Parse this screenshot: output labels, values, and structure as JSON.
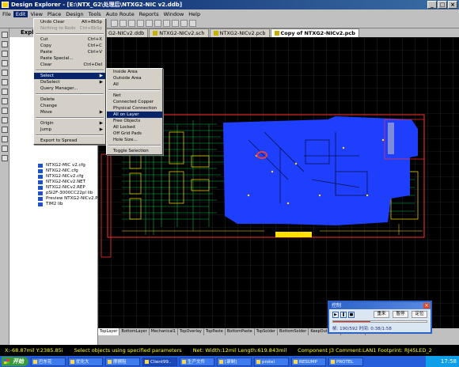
{
  "window": {
    "title": "Design Explorer - [E:\\NTX_G2\\处理后\\NTXG2-NIC v2.ddb]",
    "buttons": [
      "_",
      "□",
      "×"
    ]
  },
  "menubar": {
    "items": [
      "File",
      "Edit",
      "View",
      "Place",
      "Design",
      "Tools",
      "Auto Route",
      "Reports",
      "Window",
      "Help"
    ],
    "active": "Edit"
  },
  "explorer": {
    "header": "Expl",
    "files": [
      "NTXG2-MIC v2.cfg",
      "NTXG2-NIC.cfg",
      "NTXG2-NICv2.cfg",
      "NTXG2-NICv2.NET",
      "NTXG2-NICv2.REP",
      "pSI2F-3000CC22pl lib",
      "Preview NTXG2-NICv2.PCB",
      "TIM2 lib"
    ]
  },
  "doc_tabs": [
    {
      "label": "G2-NICv2.ddb",
      "active": false
    },
    {
      "label": "NTXG2-NICv2.sch",
      "active": false
    },
    {
      "label": "NTXG2-NICv2.pcb",
      "active": false
    },
    {
      "label": "Copy of NTXG2-NICv2.pcb",
      "active": true
    }
  ],
  "edit_menu": [
    {
      "label": "Undo  Clear",
      "shortcut": "Alt+BkSp"
    },
    {
      "label": "Nothing to Redo",
      "shortcut": "Ctrl+BkSp"
    },
    {
      "sep": true
    },
    {
      "label": "Cut",
      "shortcut": "Ctrl+X"
    },
    {
      "label": "Copy",
      "shortcut": "Ctrl+C"
    },
    {
      "label": "Paste",
      "shortcut": "Ctrl+V"
    },
    {
      "label": "Paste Special...",
      "shortcut": ""
    },
    {
      "label": "Clear",
      "shortcut": "Ctrl+Del"
    },
    {
      "sep": true
    },
    {
      "label": "Select",
      "shortcut": "",
      "submenu": true,
      "highlight": true
    },
    {
      "label": "DeSelect",
      "shortcut": "",
      "submenu": true
    },
    {
      "label": "Query Manager...",
      "shortcut": ""
    },
    {
      "sep": true
    },
    {
      "label": "Delete",
      "shortcut": ""
    },
    {
      "label": "Change",
      "shortcut": ""
    },
    {
      "label": "Move",
      "shortcut": "",
      "submenu": true
    },
    {
      "sep": true
    },
    {
      "label": "Origin",
      "shortcut": "",
      "submenu": true
    },
    {
      "label": "Jump",
      "shortcut": "",
      "submenu": true
    },
    {
      "sep": true
    },
    {
      "label": "Export to Spread",
      "shortcut": ""
    }
  ],
  "select_submenu": [
    {
      "label": "Inside Area"
    },
    {
      "label": "Outside Area"
    },
    {
      "label": "All"
    },
    {
      "sep": true
    },
    {
      "label": "Net"
    },
    {
      "label": "Connected Copper"
    },
    {
      "label": "Physical Connection"
    },
    {
      "label": "All on Layer",
      "highlight": true
    },
    {
      "label": "Free Objects"
    },
    {
      "label": "All Locked"
    },
    {
      "label": "Off Grid Pads"
    },
    {
      "label": "Hole Size..."
    },
    {
      "sep": true
    },
    {
      "label": "Toggle Selection"
    }
  ],
  "layer_tabs": [
    "TopLayer",
    "BottomLayer",
    "Mechanical1",
    "TopOverlay",
    "TopPaste",
    "BottomPaste",
    "TopSolder",
    "BottomSolder",
    "KeepOutLayer",
    "MultiLayer"
  ],
  "status": {
    "coords": "X:-68.87mil Y:2385.85i",
    "hint": "Select objects using specified parameters",
    "net": "Net: Width:12mil Length:619.843mil",
    "component": "Component J3 Comment:LAN1 Footprint: RJ45LED_2"
  },
  "player": {
    "title": "控制",
    "buttons": [
      "重来",
      "暂停",
      "定位"
    ],
    "progress_fraction": 0.4,
    "time_text": "帧: 190/592 时间: 0:38/1:58"
  },
  "taskbar": {
    "start_label": "开始",
    "tasks": [
      "巴东花",
      "优化大",
      "摩擦阻",
      "Client99..",
      "生产文件",
      "[录制]",
      "protel",
      "RESUMP",
      "PROTEL"
    ],
    "clock": "17:58"
  },
  "colors": {
    "pcb_bg": "#000000",
    "pcb_blue": "#1f3fff",
    "trace_green": "#00c850",
    "pad_yellow": "#ffe000",
    "outline_red": "#ff3030"
  }
}
